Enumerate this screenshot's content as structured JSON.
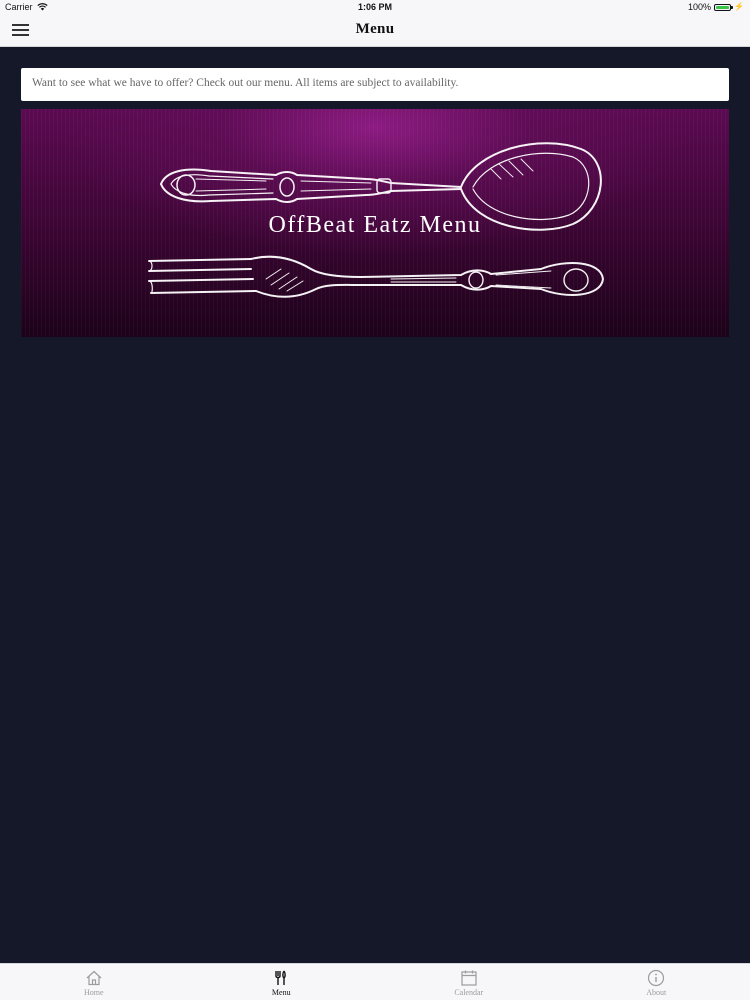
{
  "status_bar": {
    "carrier": "Carrier",
    "time": "1:06 PM",
    "battery": "100%"
  },
  "nav": {
    "title": "Menu"
  },
  "intro": {
    "text": "Want to see what we have to offer? Check out our menu. All items are subject to availability."
  },
  "banner": {
    "title": "OffBeat Eatz Menu"
  },
  "tabs": [
    {
      "label": "Home",
      "icon": "home-icon"
    },
    {
      "label": "Menu",
      "icon": "utensils-icon",
      "active": true
    },
    {
      "label": "Calendar",
      "icon": "calendar-icon"
    },
    {
      "label": "About",
      "icon": "info-icon"
    }
  ],
  "colors": {
    "background": "#151828",
    "banner_accent": "#5c0a52",
    "bar_background": "#f7f7f9",
    "battery": "#39c54a"
  }
}
